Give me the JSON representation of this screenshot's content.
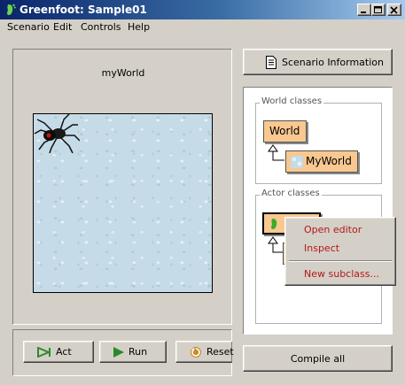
{
  "window": {
    "title": "Greenfoot: Sample01",
    "controls": [
      "minimize",
      "maximize",
      "close"
    ]
  },
  "menubar": [
    "Scenario",
    "Edit",
    "Controls",
    "Help"
  ],
  "world": {
    "name": "myWorld"
  },
  "controls": {
    "act_label": "Act",
    "run_label": "Run",
    "reset_label": "Reset"
  },
  "scenario_info_label": "Scenario Information",
  "classes": {
    "world_group_label": "World classes",
    "world_class": "World",
    "world_subclass": "MyWorld",
    "actor_group_label": "Actor classes"
  },
  "context_menu": {
    "items": [
      "Open editor",
      "Inspect",
      "New subclass..."
    ]
  },
  "compile_label": "Compile all",
  "colors": {
    "class_box": "#f8c890",
    "titlebar": "#0a246a",
    "menu_text": "#b21818"
  }
}
